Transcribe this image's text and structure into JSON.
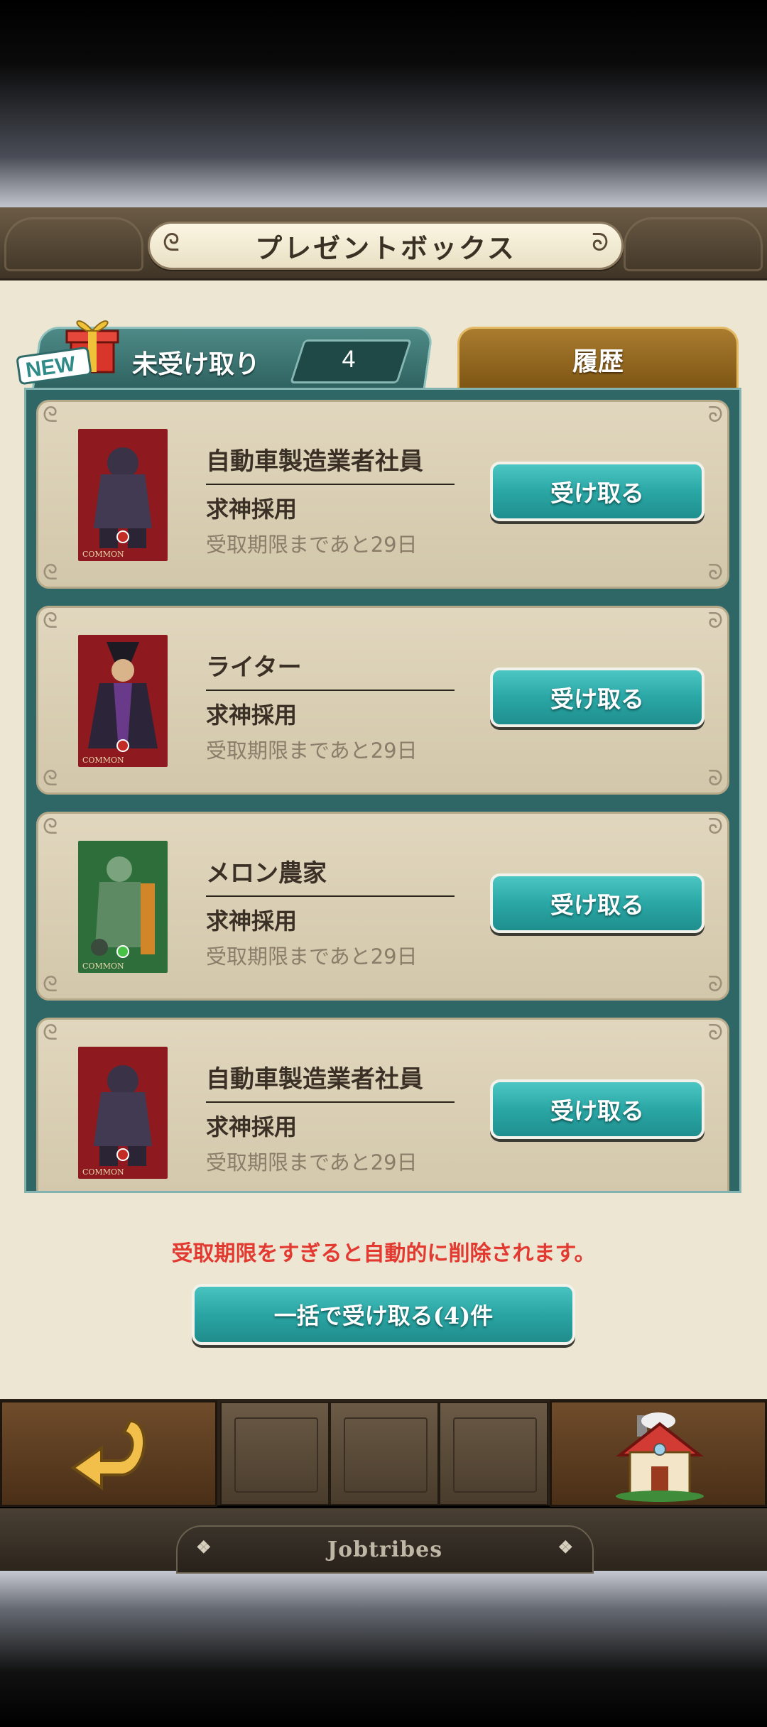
{
  "header": {
    "title": "プレゼントボックス"
  },
  "tabs": {
    "new_badge": "NEW",
    "unreceived_label": "未受け取り",
    "unreceived_count": "4",
    "history_label": "履歴"
  },
  "items": [
    {
      "name": "自動車製造業者社員",
      "type": "求神採用",
      "expiry": "受取期限まであと29日",
      "button": "受け取る",
      "thumb_color": "#8e1a1f"
    },
    {
      "name": "ライター",
      "type": "求神採用",
      "expiry": "受取期限まであと29日",
      "button": "受け取る",
      "thumb_color": "#8e1a1f"
    },
    {
      "name": "メロン農家",
      "type": "求神採用",
      "expiry": "受取期限まであと29日",
      "button": "受け取る",
      "thumb_color": "#2e6e3a"
    },
    {
      "name": "自動車製造業者社員",
      "type": "求神採用",
      "expiry": "受取期限まであと29日",
      "button": "受け取る",
      "thumb_color": "#8e1a1f"
    }
  ],
  "notice": "受取期限をすぎると自動的に削除されます。",
  "bulk_button": "一括で受け取る(4)件",
  "footer": {
    "brand": "Jobtribes"
  }
}
